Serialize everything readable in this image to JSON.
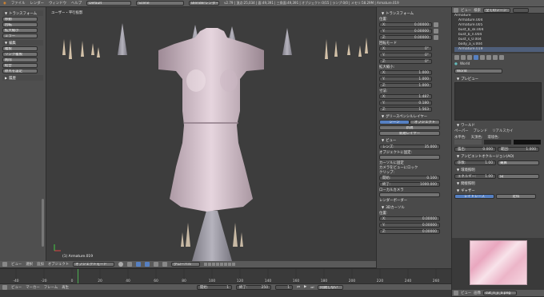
{
  "topbar": {
    "menus": [
      "ファイル",
      "レンダー",
      "ウィンドウ",
      "ヘルプ"
    ],
    "layout": "Default",
    "scene": "Scene",
    "engine": "Blenderレンダー",
    "stats": "v2.79 | 頂点:25,034 | 面:49,391 | 三角面:49,391 | オブジェクト:0/15 | ランプ:0/0 | メモリ:58.29M | Armature.019"
  },
  "toolshelf": {
    "transform_header": "トランスフォーム",
    "transform_buttons": [
      "移動",
      "回転",
      "拡大縮小",
      "ミラー"
    ],
    "edit_header": "編集",
    "edit_buttons": [
      "複製",
      "リンク複製",
      "削除",
      "結合",
      "原点を設定"
    ],
    "history_header": "履歴"
  },
  "viewport": {
    "title": "ユーザー・平行投影",
    "object_label": "(1) Armature.019"
  },
  "viewport_header": {
    "items": [
      "ビュー",
      "選択",
      "追加",
      "オブジェクト"
    ],
    "mode": "オブジェクトモード",
    "pivot": "グローバル"
  },
  "npanel": {
    "transform_header": "トランスフォーム",
    "location_label": "位置:",
    "location": [
      {
        "axis": "X:",
        "value": "0.00000"
      },
      {
        "axis": "Y:",
        "value": "0.00000"
      },
      {
        "axis": "Z:",
        "value": "0.00000"
      }
    ],
    "rotation_header": "回転モード",
    "rotation": [
      {
        "axis": "X:",
        "value": "0°"
      },
      {
        "axis": "Y:",
        "value": "0°"
      },
      {
        "axis": "Z:",
        "value": "0°"
      }
    ],
    "scale_label": "拡大縮小:",
    "scale": [
      {
        "axis": "X:",
        "value": "1.000"
      },
      {
        "axis": "Y:",
        "value": "1.000"
      },
      {
        "axis": "Z:",
        "value": "1.000"
      }
    ],
    "dimensions_label": "寸法:",
    "dimensions": [
      {
        "axis": "X:",
        "value": "1.487"
      },
      {
        "axis": "Y:",
        "value": "0.180"
      },
      {
        "axis": "Z:",
        "value": "1.563"
      }
    ],
    "grease_header": "グリースペンシルレイヤー",
    "grease_tabs": [
      "シーン",
      "オブジェクト"
    ],
    "grease_new": "新規",
    "grease_new_layer": "新規レイヤー",
    "view_header": "ビュー",
    "lens_label": "レンズ:",
    "lens_value": "35.000",
    "lock_label": "オブジェクトに固定:",
    "lock_cursor": "カーソルに固定",
    "camera_lock": "カメラをビューにロック",
    "clip_label": "クリップ:",
    "clip_start_label": "開始:",
    "clip_start": "0.100",
    "clip_end_label": "終了:",
    "clip_end": "1000.000",
    "local_camera": "ローカルカメラ",
    "render_border": "レンダーボーダー",
    "cursor_header": "3Dカーソル",
    "cursor_label": "位置:",
    "cursor": [
      {
        "axis": "X:",
        "value": "0.00000"
      },
      {
        "axis": "Y:",
        "value": "0.00000"
      },
      {
        "axis": "Z:",
        "value": "0.00000"
      }
    ]
  },
  "outliner": {
    "view": "ビュー",
    "search": "検索",
    "filter": "全てのシーン",
    "items": [
      "Armature",
      "Armature.004",
      "Armature.005",
      "bust_b_sk.004",
      "bust_b_n.004",
      "bust_s_0.004",
      "body_a_v.004",
      "Armature.019",
      "ポーズ"
    ]
  },
  "properties": {
    "world_name": "World",
    "world_field": "World",
    "preview_header": "プレビュー",
    "world_header": "ワールド",
    "world_opts": [
      "ペーパー",
      "ブレンド",
      "リアルスカイ"
    ],
    "color_labels": [
      "水平色:",
      "天頂色:",
      "環境色:"
    ],
    "exposure_label": "露出:",
    "exposure": "0.000",
    "range_label": "範囲:",
    "range": "1.000",
    "ao_header": "アンビエントオクルージョン(AO)",
    "ao_factor_label": "係数:",
    "ao_factor": "1.00",
    "ao_mode": "乗算",
    "env_header": "環境照明",
    "env_energy_label": "エネルギー:",
    "env_energy": "1.00",
    "env_color": "白",
    "indirect_header": "間接照明",
    "gather_header": "ギャザー",
    "gather_items": [
      "レイトレース",
      "近似"
    ]
  },
  "timeline": {
    "ticks": [
      "-40",
      "-20",
      "0",
      "20",
      "40",
      "60",
      "80",
      "100",
      "120",
      "140",
      "160",
      "180",
      "200",
      "220",
      "240",
      "260"
    ],
    "menus": [
      "ビュー",
      "マーカー",
      "フレーム",
      "再生"
    ],
    "start_label": "開始:",
    "start": "1",
    "end_label": "終了:",
    "end": "250",
    "current": "1",
    "sync": "同期しない"
  },
  "uvpanel": {
    "image": "cut_n_ji_a.png",
    "view": "ビュー",
    "image_menu": "画像"
  },
  "colors": {
    "accent": "#5680c2",
    "active": "#e08a2c",
    "bg": "#3d3d3d",
    "panel": "#4a4a4a"
  }
}
